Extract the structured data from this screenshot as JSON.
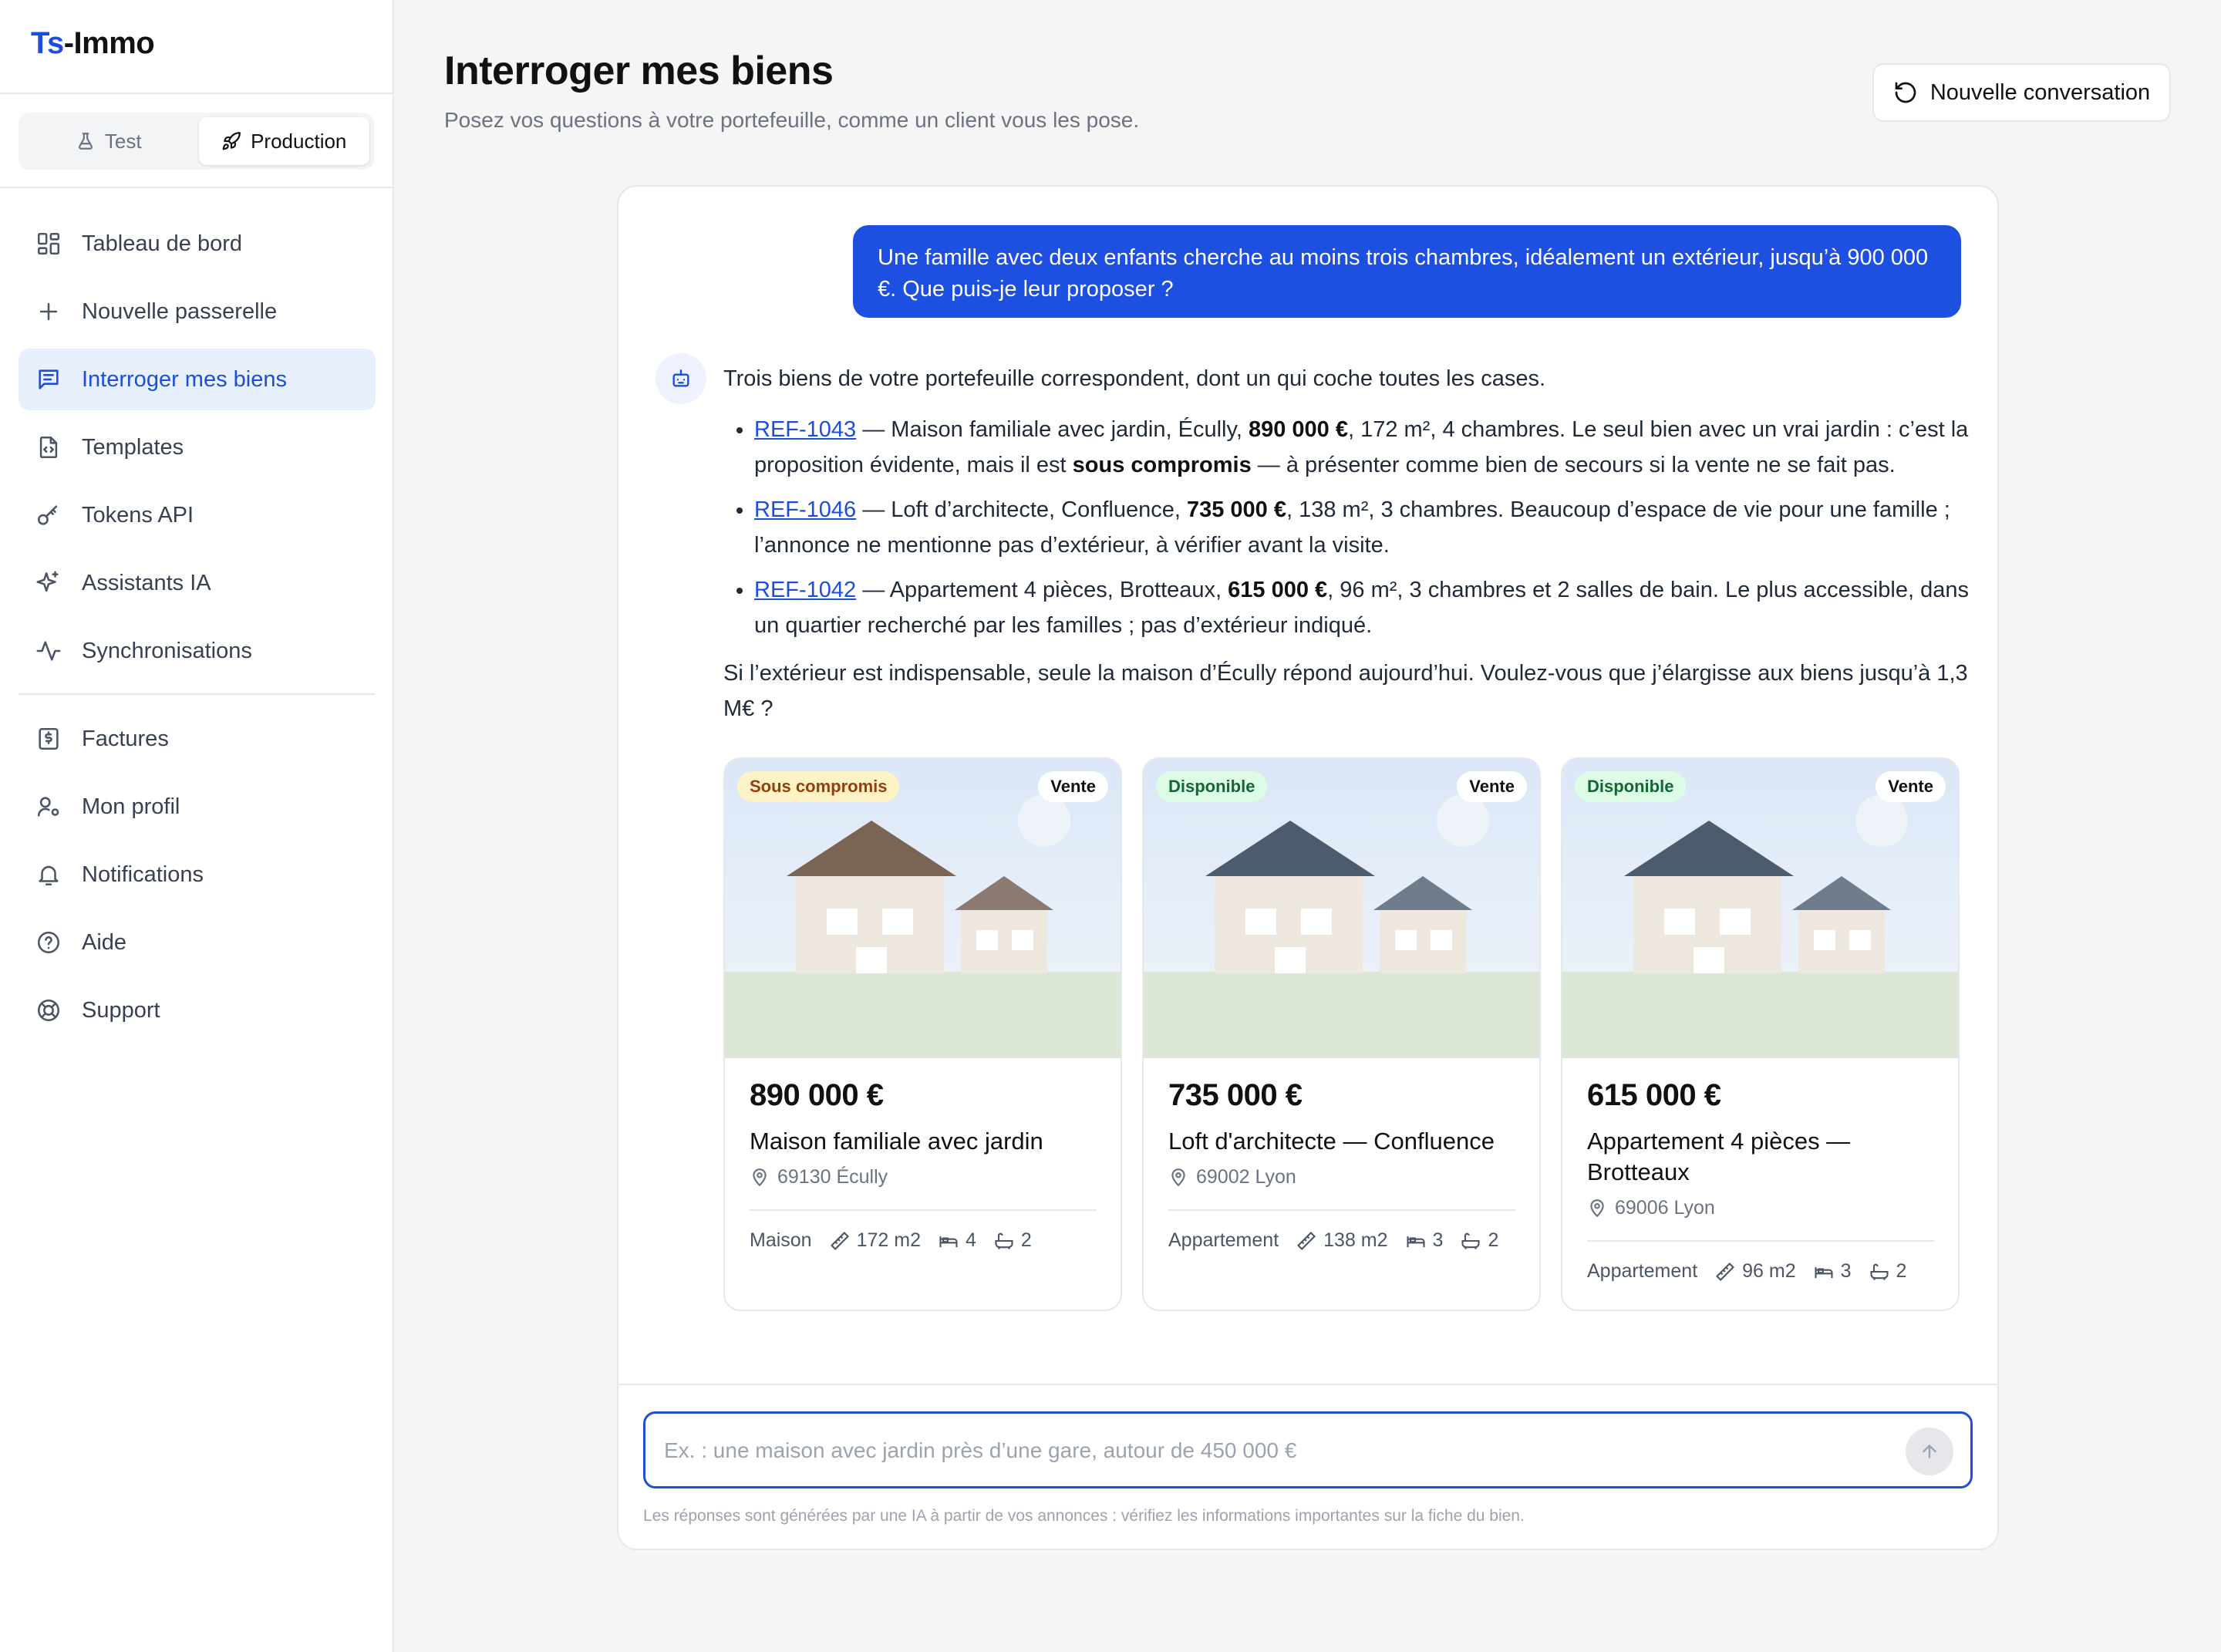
{
  "app": {
    "logo_prefix": "Ts",
    "logo_suffix": "-Immo"
  },
  "env": {
    "test": "Test",
    "production": "Production",
    "selected": "Production"
  },
  "nav": {
    "items": [
      {
        "label": "Tableau de bord",
        "icon": "dashboard-icon"
      },
      {
        "label": "Nouvelle passerelle",
        "icon": "plus-icon"
      },
      {
        "label": "Interroger mes biens",
        "icon": "chat-icon",
        "active": true
      },
      {
        "label": "Templates",
        "icon": "file-code-icon"
      },
      {
        "label": "Tokens API",
        "icon": "key-icon"
      },
      {
        "label": "Assistants IA",
        "icon": "sparkles-icon"
      },
      {
        "label": "Synchronisations",
        "icon": "activity-icon"
      }
    ],
    "items2": [
      {
        "label": "Factures",
        "icon": "invoice-icon"
      },
      {
        "label": "Mon profil",
        "icon": "user-cog-icon"
      },
      {
        "label": "Notifications",
        "icon": "bell-icon"
      },
      {
        "label": "Aide",
        "icon": "help-icon"
      },
      {
        "label": "Support",
        "icon": "lifebuoy-icon"
      }
    ]
  },
  "header": {
    "title": "Interroger mes biens",
    "subtitle": "Posez vos questions à votre portefeuille, comme un client vous les pose.",
    "new_conversation": "Nouvelle conversation"
  },
  "chat": {
    "user_message": "Une famille avec deux enfants cherche au moins trois chambres, idéalement un extérieur, jusqu’à 900 000 €. Que puis-je leur proposer ?",
    "answer_intro": "Trois biens de votre portefeuille correspondent, dont un qui coche toutes les cases.",
    "bullets": [
      {
        "ref": "REF-1043",
        "p1": " — Maison familiale avec jardin, Écully, ",
        "b1": "890 000 €",
        "p2": ", 172 m², 4 chambres. Le seul bien avec un vrai jardin : c’est la proposition évidente, mais il est ",
        "b2": "sous compromis",
        "p3": " — à présenter comme bien de secours si la vente ne se fait pas."
      },
      {
        "ref": "REF-1046",
        "p1": " — Loft d’architecte, Confluence, ",
        "b1": "735 000 €",
        "p2": ", 138 m², 3 chambres. Beaucoup d’espace de vie pour une famille ; l’annonce ne mentionne pas d’extérieur, à vérifier avant la visite.",
        "b2": "",
        "p3": ""
      },
      {
        "ref": "REF-1042",
        "p1": " — Appartement 4 pièces, Brotteaux, ",
        "b1": "615 000 €",
        "p2": ", 96 m², 3 chambres et 2 salles de bain. Le plus accessible, dans un quartier recherché par les familles ; pas d’extérieur indiqué.",
        "b2": "",
        "p3": ""
      }
    ],
    "answer_outro": "Si l’extérieur est indispensable, seule la maison d’Écully répond aujourd’hui. Voulez-vous que j’élargisse aux biens jusqu’à 1,3 M€ ?"
  },
  "cards": [
    {
      "status": "Sous compromis",
      "status_color": "#fef3c7",
      "type": "Vente",
      "price": "890 000 €",
      "title": "Maison familiale avec jardin",
      "location": "69130 Écully",
      "kind": "Maison",
      "area": "172 m2",
      "beds": "4",
      "baths": "2",
      "roof": "#7a6555",
      "roof2": "#8a7a70"
    },
    {
      "status": "Disponible",
      "status_color": "#dcfce7",
      "type": "Vente",
      "price": "735 000 €",
      "title": "Loft d'architecte — Confluence",
      "location": "69002 Lyon",
      "kind": "Appartement",
      "area": "138 m2",
      "beds": "3",
      "baths": "2",
      "roof": "#4d5b6e",
      "roof2": "#6f7c8c"
    },
    {
      "status": "Disponible",
      "status_color": "#dcfce7",
      "type": "Vente",
      "price": "615 000 €",
      "title": "Appartement 4 pièces — Brotteaux",
      "location": "69006 Lyon",
      "kind": "Appartement",
      "area": "96 m2",
      "beds": "3",
      "baths": "2",
      "roof": "#4d5b6e",
      "roof2": "#6f7c8c"
    }
  ],
  "composer": {
    "placeholder": "Ex. : une maison avec jardin près d’une gare, autour de 450 000 €",
    "disclaimer": "Les réponses sont générées par une IA à partir de vos annonces : vérifiez les informations importantes sur la fiche du bien."
  }
}
